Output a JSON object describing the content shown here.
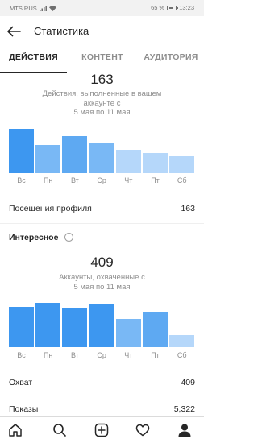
{
  "status_bar": {
    "carrier": "MTS RUS",
    "battery": "65 %",
    "time": "13:23"
  },
  "header": {
    "title": "Статистика"
  },
  "tabs": [
    {
      "label": "ДЕЙСТВИЯ",
      "active": true
    },
    {
      "label": "КОНТЕНТ",
      "active": false
    },
    {
      "label": "АУДИТОРИЯ",
      "active": false
    }
  ],
  "actions": {
    "total": "163",
    "desc_line1": "Действия, выполненные в вашем",
    "desc_line2": "аккаунте с",
    "desc_line3": "5 мая по 11 мая"
  },
  "chart_data": [
    {
      "type": "bar",
      "categories": [
        "Вс",
        "Пн",
        "Вт",
        "Ср",
        "Чт",
        "Пт",
        "Сб"
      ],
      "values": [
        49,
        31,
        41,
        34,
        26,
        22,
        19
      ],
      "colors": [
        "#3d97f0",
        "#79b8f5",
        "#5ea9f2",
        "#79b8f5",
        "#b5d7fa",
        "#b5d7fa",
        "#b5d7fa"
      ]
    },
    {
      "type": "bar",
      "categories": [
        "Вс",
        "Пн",
        "Вт",
        "Ср",
        "Чт",
        "Пт",
        "Сб"
      ],
      "values": [
        45,
        49,
        43,
        47,
        31,
        39,
        13
      ],
      "colors": [
        "#3d97f0",
        "#3d97f0",
        "#3d97f0",
        "#3d97f0",
        "#79b8f5",
        "#5ea9f2",
        "#b5d7fa"
      ]
    }
  ],
  "profile_visits": {
    "label": "Посещения профиля",
    "value": "163"
  },
  "discovery": {
    "title": "Интересное",
    "info_icon": "i",
    "total": "409",
    "desc_line1": "Аккаунты, охваченные с",
    "desc_line2": "5 мая по 11 мая"
  },
  "reach": {
    "label": "Охват",
    "value": "409"
  },
  "impressions": {
    "label": "Показы",
    "value": "5,322"
  },
  "nav": [
    "home-icon",
    "search-icon",
    "add-post-icon",
    "heart-icon",
    "profile-icon"
  ]
}
